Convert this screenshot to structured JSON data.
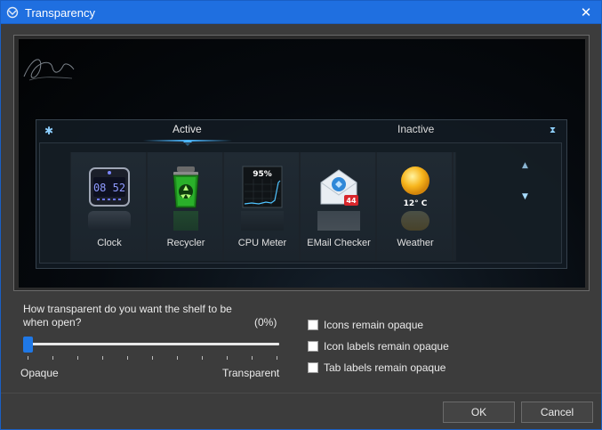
{
  "window": {
    "title": "Transparency",
    "close_glyph": "✕",
    "icon": "app-icon"
  },
  "preview": {
    "tabs": [
      {
        "label": "Active"
      },
      {
        "label": "Inactive"
      }
    ],
    "icons": [
      {
        "label": "Clock",
        "icon": "clock-icon",
        "clock_text": "08 52"
      },
      {
        "label": "Recycler",
        "icon": "recycler-icon"
      },
      {
        "label": "CPU Meter",
        "icon": "cpu-meter-icon",
        "value_text": "95%"
      },
      {
        "label": "EMail Checker",
        "icon": "email-checker-icon",
        "badge": "44"
      },
      {
        "label": "Weather",
        "icon": "weather-icon",
        "temp_text": "12° C"
      }
    ],
    "gear_glyph": "✱",
    "collapse_glyph": "⧗",
    "scroll_up_glyph": "▲",
    "scroll_down_glyph": "▼"
  },
  "transparency": {
    "question": "How transparent do you want the shelf to be when open?",
    "percent_text": "(0%)",
    "value_percent": 0,
    "min_label": "Opaque",
    "max_label": "Transparent"
  },
  "options": [
    {
      "label": "Icons remain opaque",
      "checked": false
    },
    {
      "label": "Icon labels remain opaque",
      "checked": false
    },
    {
      "label": "Tab labels remain opaque",
      "checked": false
    }
  ],
  "buttons": {
    "ok": "OK",
    "cancel": "Cancel"
  },
  "colors": {
    "titlebar": "#1f6fe0",
    "accent": "#1f78e6",
    "tab_highlight": "#4db8ff"
  }
}
